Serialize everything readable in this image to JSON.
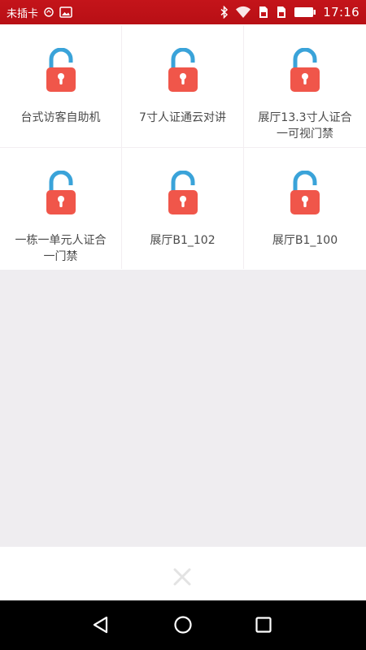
{
  "status_bar": {
    "carrier": "未插卡",
    "time": "17:16",
    "icons": [
      "usb-icon",
      "image-icon",
      "bluetooth-icon",
      "wifi-icon",
      "sim-icon",
      "sim-icon",
      "battery-icon"
    ]
  },
  "grid": {
    "items": [
      {
        "label_line1": "台式访客自助机",
        "label_line2": "",
        "icon": "lock-icon"
      },
      {
        "label_line1": "7寸人证通云对讲",
        "label_line2": "",
        "icon": "lock-icon"
      },
      {
        "label_line1": "展厅13.3寸人证合",
        "label_line2": "一可视门禁",
        "icon": "lock-icon"
      },
      {
        "label_line1": "一栋一单元人证合",
        "label_line2": "一门禁",
        "icon": "lock-icon"
      },
      {
        "label_line1": "展厅B1_102",
        "label_line2": "",
        "icon": "lock-icon"
      },
      {
        "label_line1": "展厅B1_100",
        "label_line2": "",
        "icon": "lock-icon"
      }
    ]
  },
  "colors": {
    "status_bar": "#c4141a",
    "lock_body": "#f0564a",
    "lock_shackle": "#3aa3d9",
    "empty_area": "#efedf0"
  },
  "close_bar": {
    "icon": "close-icon"
  },
  "nav_bar": {
    "icons": [
      "back-icon",
      "home-icon",
      "recent-apps-icon"
    ]
  }
}
